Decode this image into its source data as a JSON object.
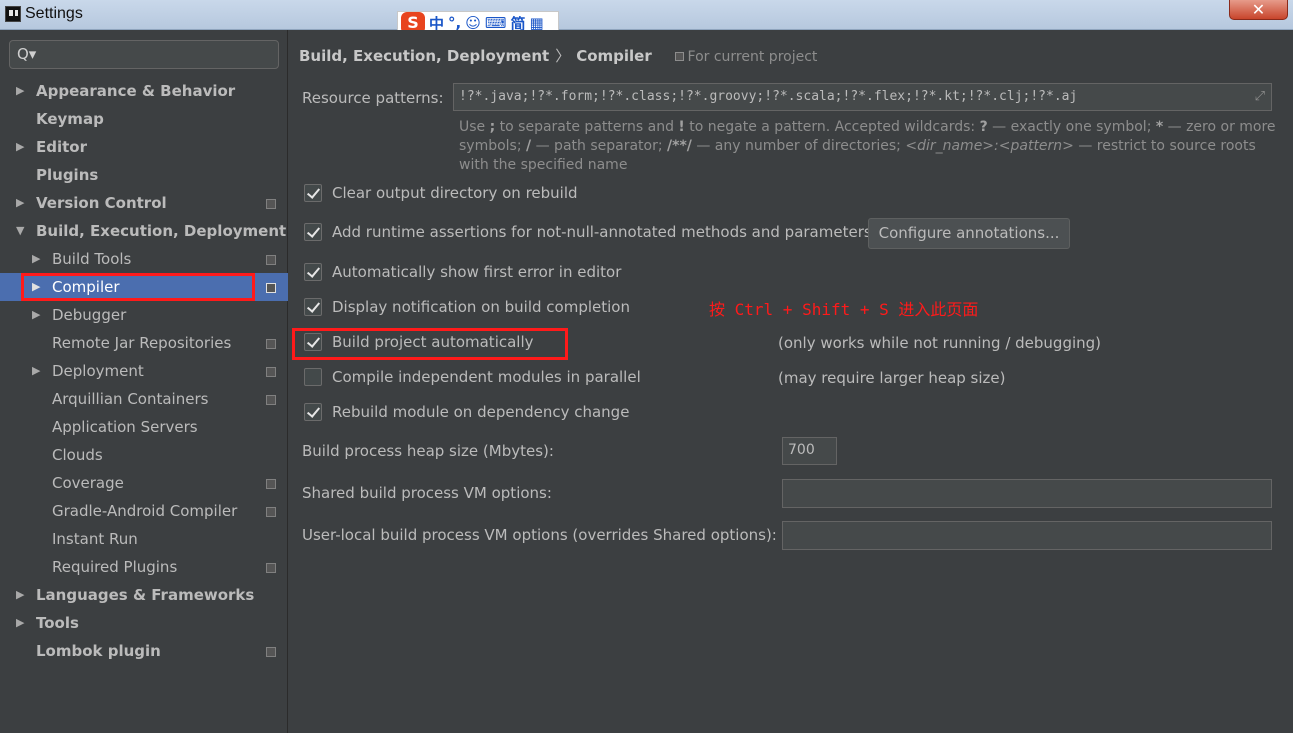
{
  "window": {
    "title": "Settings",
    "close_glyph": "✕"
  },
  "ime": {
    "logo": "S",
    "items": [
      "中",
      "°,",
      "☺",
      "⌨",
      "简",
      "▦"
    ]
  },
  "sidebar": {
    "search_icon": "Q▾",
    "items": [
      {
        "label": "Appearance & Behavior",
        "arrow": "▶"
      },
      {
        "label": "Keymap",
        "arrow": ""
      },
      {
        "label": "Editor",
        "arrow": "▶"
      },
      {
        "label": "Plugins",
        "arrow": ""
      },
      {
        "label": "Version Control",
        "arrow": "▶"
      },
      {
        "label": "Build, Execution, Deployment",
        "arrow": "▼"
      },
      {
        "label": "Build Tools",
        "arrow": "▶"
      },
      {
        "label": "Compiler",
        "arrow": "▶"
      },
      {
        "label": "Debugger",
        "arrow": "▶"
      },
      {
        "label": "Remote Jar Repositories",
        "arrow": ""
      },
      {
        "label": "Deployment",
        "arrow": "▶"
      },
      {
        "label": "Arquillian Containers",
        "arrow": ""
      },
      {
        "label": "Application Servers",
        "arrow": ""
      },
      {
        "label": "Clouds",
        "arrow": ""
      },
      {
        "label": "Coverage",
        "arrow": ""
      },
      {
        "label": "Gradle-Android Compiler",
        "arrow": ""
      },
      {
        "label": "Instant Run",
        "arrow": ""
      },
      {
        "label": "Required Plugins",
        "arrow": ""
      },
      {
        "label": "Languages & Frameworks",
        "arrow": "▶"
      },
      {
        "label": "Tools",
        "arrow": "▶"
      },
      {
        "label": "Lombok plugin",
        "arrow": ""
      }
    ]
  },
  "breadcrumb": {
    "parent": "Build, Execution, Deployment",
    "separator": "〉",
    "current": "Compiler",
    "scope": "For current project"
  },
  "resource_patterns": {
    "label": "Resource patterns:",
    "value": "!?*.java;!?*.form;!?*.class;!?*.groovy;!?*.scala;!?*.flex;!?*.kt;!?*.clj;!?*.aj",
    "expand_glyph": "⤢"
  },
  "hint": {
    "p1": "Use ",
    "semicolon": ";",
    "p2": " to separate patterns and ",
    "bang": "!",
    "p3": " to negate a pattern. Accepted wildcards: ",
    "q": "?",
    "p4": " — exactly one symbol; ",
    "star": "*",
    "p5": " — zero or more symbols; ",
    "slash": "/",
    "p6": " — path separator; ",
    "dstar": "/**/",
    "p7": " — any number of directories; ",
    "dir": "<dir_name>:<pattern>",
    "p8": " — restrict to source roots with the specified name"
  },
  "options": [
    {
      "label": "Clear output directory on rebuild",
      "checked": true
    },
    {
      "label": "Add runtime assertions for not-null-annotated methods and parameters",
      "checked": true
    },
    {
      "label": "Automatically show first error in editor",
      "checked": true
    },
    {
      "label": "Display notification on build completion",
      "checked": true
    },
    {
      "label": "Build project automatically",
      "checked": true
    },
    {
      "label": "Compile independent modules in parallel",
      "checked": false
    },
    {
      "label": "Rebuild module on dependency change",
      "checked": true
    }
  ],
  "configure_annotations_button": "Configure annotations...",
  "notes": {
    "build_auto": "(only works while not running / debugging)",
    "parallel": "(may require larger heap size)"
  },
  "annotation_text": "按 Ctrl + Shift + S 进入此页面",
  "heap_size": {
    "label": "Build process heap size (Mbytes):",
    "value": "700"
  },
  "shared_vm": {
    "label": "Shared build process VM options:",
    "value": ""
  },
  "user_vm": {
    "label": "User-local build process VM options (overrides Shared options):",
    "value": ""
  },
  "colors": {
    "selection": "#4b6eaf",
    "highlight_red": "#ff1a1a",
    "background": "#3c3f41"
  }
}
